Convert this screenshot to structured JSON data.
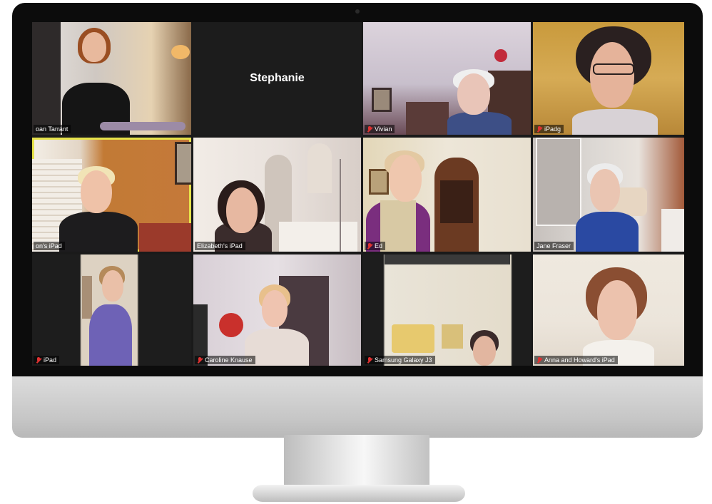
{
  "meeting": {
    "tiles": [
      {
        "name": "oan Tarrant",
        "muted": false
      },
      {
        "name": "Stephanie",
        "video": false
      },
      {
        "name": "Vivian",
        "muted": true
      },
      {
        "name": "iPadg",
        "muted": true
      },
      {
        "name": "on's iPad",
        "muted": false,
        "active_speaker": true
      },
      {
        "name": "Elizabeth's iPad",
        "muted": false
      },
      {
        "name": "Ed",
        "muted": true
      },
      {
        "name": "Jane Fraser",
        "muted": false
      },
      {
        "name": "iPad",
        "muted": true
      },
      {
        "name": "Caroline Knause",
        "muted": true
      },
      {
        "name": "Samsung Galaxy J3",
        "muted": true
      },
      {
        "name": "Anna and Howard's iPad",
        "muted": true
      }
    ]
  },
  "colors": {
    "active_speaker_border": "#e6e24a",
    "muted_icon": "#e03232",
    "bezel": "#0c0c0c"
  },
  "icons": {
    "muted": "microphone-muted-icon"
  }
}
